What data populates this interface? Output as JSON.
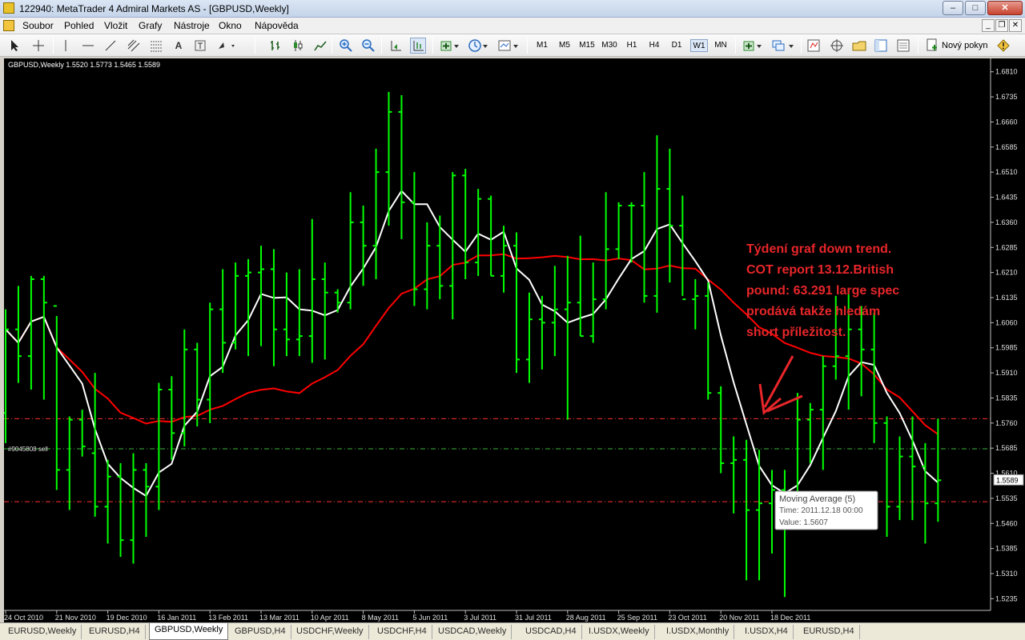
{
  "window": {
    "title": "122940: MetaTrader 4 Admiral Markets AS - [GBPUSD,Weekly]",
    "minimize": "–",
    "maximize": "□",
    "close": "✕",
    "mdi_minimize": "_",
    "mdi_restore": "❐",
    "mdi_close": "✕"
  },
  "menu": [
    "Soubor",
    "Pohled",
    "Vložit",
    "Grafy",
    "Nástroje",
    "Okno",
    "Nápověda"
  ],
  "toolbar": {
    "timeframes": [
      "M1",
      "M5",
      "M15",
      "M30",
      "H1",
      "H4",
      "D1",
      "W1",
      "MN"
    ],
    "active_timeframe": "W1",
    "new_order_label": "Nový pokyn",
    "tools": [
      "cursor-icon",
      "crosshair-icon",
      "vertical-line-icon",
      "horizontal-line-icon",
      "trendline-icon",
      "equidistant-channel-icon",
      "fibonacci-icon",
      "text-icon",
      "text-label-icon",
      "arrows-icon",
      "bar-chart-icon",
      "candlestick-icon",
      "line-chart-icon",
      "zoom-in-icon",
      "zoom-out-icon",
      "chart-shift-icon",
      "autoscroll-icon",
      "indicators-icon",
      "periods-icon",
      "templates-icon",
      "new-chart-icon",
      "profiles-icon",
      "market-watch-icon",
      "navigator-icon",
      "expert-advisors-icon",
      "data-window-icon",
      "terminal-icon",
      "new-order-icon",
      "metaeditor-icon"
    ]
  },
  "chart": {
    "header": "GBPUSD,Weekly  1.5520 1.5773 1.5465 1.5589",
    "symbol": "GBPUSD",
    "current_price_label": "1.5589",
    "order_label": "#9045808 sell",
    "background": "#000000",
    "bar_color": "#00ff00",
    "ma_fast_color": "#ffffff",
    "ma_slow_color": "#ff0000",
    "annotation": [
      "Týdení graf down trend.",
      "COT report 13.12.British",
      "pound: 63.291 large spec",
      "prodává takže hledám",
      "short příležitost."
    ],
    "annotation_color": "#e8262a",
    "tooltip": {
      "title": "Moving Average (5)",
      "time": "Time: 2011.12.18 00:00",
      "value": "Value: 1.5607"
    }
  },
  "chart_data": {
    "type": "ohlc",
    "ylim": [
      1.52,
      1.685
    ],
    "y_ticks": [
      "1.6810",
      "1.6735",
      "1.6660",
      "1.6585",
      "1.6510",
      "1.6435",
      "1.6360",
      "1.6285",
      "1.6210",
      "1.6135",
      "1.6060",
      "1.5985",
      "1.5910",
      "1.5835",
      "1.5760",
      "1.5685",
      "1.5610",
      "1.5535",
      "1.5460",
      "1.5385",
      "1.5310",
      "1.5235"
    ],
    "x_labels": [
      "24 Oct 2010",
      "21 Nov 2010",
      "19 Dec 2010",
      "16 Jan 2011",
      "13 Feb 2011",
      "13 Mar 2011",
      "10 Apr 2011",
      "8 May 2011",
      "5 Jun 2011",
      "3 Jul 2011",
      "31 Jul 2011",
      "28 Aug 2011",
      "25 Sep 2011",
      "23 Oct 2011",
      "20 Nov 2011",
      "18 Dec 2011"
    ],
    "horizontal_lines": [
      {
        "value": 1.5773,
        "color": "#ff3030",
        "style": "dash-dot"
      },
      {
        "value": 1.5683,
        "color": "#3cb43c",
        "style": "dash-dot"
      },
      {
        "value": 1.5525,
        "color": "#ff3030",
        "style": "dash-dot"
      }
    ],
    "bars": [
      {
        "o": 1.579,
        "h": 1.61,
        "l": 1.57,
        "c": 1.604
      },
      {
        "o": 1.604,
        "h": 1.617,
        "l": 1.588,
        "c": 1.596
      },
      {
        "o": 1.596,
        "h": 1.62,
        "l": 1.586,
        "c": 1.619
      },
      {
        "o": 1.619,
        "h": 1.62,
        "l": 1.583,
        "c": 1.612
      },
      {
        "o": 1.611,
        "h": 1.608,
        "l": 1.556,
        "c": 1.562
      },
      {
        "o": 1.562,
        "h": 1.578,
        "l": 1.55,
        "c": 1.577
      },
      {
        "o": 1.577,
        "h": 1.58,
        "l": 1.566,
        "c": 1.569
      },
      {
        "o": 1.567,
        "h": 1.591,
        "l": 1.548,
        "c": 1.551
      },
      {
        "o": 1.551,
        "h": 1.565,
        "l": 1.54,
        "c": 1.56
      },
      {
        "o": 1.56,
        "h": 1.564,
        "l": 1.536,
        "c": 1.541
      },
      {
        "o": 1.541,
        "h": 1.567,
        "l": 1.534,
        "c": 1.562
      },
      {
        "o": 1.562,
        "h": 1.564,
        "l": 1.542,
        "c": 1.557
      },
      {
        "o": 1.557,
        "h": 1.588,
        "l": 1.55,
        "c": 1.586
      },
      {
        "o": 1.586,
        "h": 1.59,
        "l": 1.565,
        "c": 1.573
      },
      {
        "o": 1.573,
        "h": 1.604,
        "l": 1.569,
        "c": 1.598
      },
      {
        "o": 1.598,
        "h": 1.6,
        "l": 1.575,
        "c": 1.583
      },
      {
        "o": 1.583,
        "h": 1.612,
        "l": 1.576,
        "c": 1.61
      },
      {
        "o": 1.61,
        "h": 1.622,
        "l": 1.591,
        "c": 1.6
      },
      {
        "o": 1.6,
        "h": 1.624,
        "l": 1.598,
        "c": 1.62
      },
      {
        "o": 1.62,
        "h": 1.625,
        "l": 1.596,
        "c": 1.621
      },
      {
        "o": 1.621,
        "h": 1.629,
        "l": 1.599,
        "c": 1.622
      },
      {
        "o": 1.622,
        "h": 1.628,
        "l": 1.593,
        "c": 1.604
      },
      {
        "o": 1.604,
        "h": 1.621,
        "l": 1.596,
        "c": 1.601
      },
      {
        "o": 1.601,
        "h": 1.622,
        "l": 1.596,
        "c": 1.602
      },
      {
        "o": 1.602,
        "h": 1.637,
        "l": 1.594,
        "c": 1.619
      },
      {
        "o": 1.619,
        "h": 1.624,
        "l": 1.595,
        "c": 1.615
      },
      {
        "o": 1.615,
        "h": 1.616,
        "l": 1.609,
        "c": 1.612
      },
      {
        "o": 1.612,
        "h": 1.645,
        "l": 1.61,
        "c": 1.636
      },
      {
        "o": 1.636,
        "h": 1.641,
        "l": 1.617,
        "c": 1.629
      },
      {
        "o": 1.629,
        "h": 1.658,
        "l": 1.619,
        "c": 1.651
      },
      {
        "o": 1.651,
        "h": 1.675,
        "l": 1.635,
        "c": 1.669
      },
      {
        "o": 1.669,
        "h": 1.674,
        "l": 1.631,
        "c": 1.642
      },
      {
        "o": 1.642,
        "h": 1.651,
        "l": 1.611,
        "c": 1.616
      },
      {
        "o": 1.616,
        "h": 1.636,
        "l": 1.61,
        "c": 1.629
      },
      {
        "o": 1.629,
        "h": 1.638,
        "l": 1.613,
        "c": 1.617
      },
      {
        "o": 1.617,
        "h": 1.651,
        "l": 1.607,
        "c": 1.65
      },
      {
        "o": 1.65,
        "h": 1.652,
        "l": 1.619,
        "c": 1.624
      },
      {
        "o": 1.624,
        "h": 1.646,
        "l": 1.62,
        "c": 1.643
      },
      {
        "o": 1.643,
        "h": 1.644,
        "l": 1.62,
        "c": 1.62
      },
      {
        "o": 1.62,
        "h": 1.635,
        "l": 1.615,
        "c": 1.629
      },
      {
        "o": 1.629,
        "h": 1.633,
        "l": 1.591,
        "c": 1.595
      },
      {
        "o": 1.595,
        "h": 1.615,
        "l": 1.588,
        "c": 1.607
      },
      {
        "o": 1.607,
        "h": 1.614,
        "l": 1.592,
        "c": 1.606
      },
      {
        "o": 1.606,
        "h": 1.623,
        "l": 1.596,
        "c": 1.61
      },
      {
        "o": 1.61,
        "h": 1.626,
        "l": 1.577,
        "c": 1.612
      },
      {
        "o": 1.612,
        "h": 1.632,
        "l": 1.602,
        "c": 1.602
      },
      {
        "o": 1.602,
        "h": 1.624,
        "l": 1.6,
        "c": 1.613
      },
      {
        "o": 1.613,
        "h": 1.645,
        "l": 1.61,
        "c": 1.628
      },
      {
        "o": 1.628,
        "h": 1.642,
        "l": 1.625,
        "c": 1.641
      },
      {
        "o": 1.641,
        "h": 1.642,
        "l": 1.624,
        "c": 1.641
      },
      {
        "o": 1.641,
        "h": 1.651,
        "l": 1.612,
        "c": 1.614
      },
      {
        "o": 1.614,
        "h": 1.662,
        "l": 1.609,
        "c": 1.646
      },
      {
        "o": 1.646,
        "h": 1.658,
        "l": 1.618,
        "c": 1.635
      },
      {
        "o": 1.635,
        "h": 1.644,
        "l": 1.614,
        "c": 1.613
      },
      {
        "o": 1.613,
        "h": 1.619,
        "l": 1.604,
        "c": 1.614
      },
      {
        "o": 1.614,
        "h": 1.618,
        "l": 1.583,
        "c": 1.585
      },
      {
        "o": 1.585,
        "h": 1.587,
        "l": 1.561,
        "c": 1.564
      },
      {
        "o": 1.564,
        "h": 1.572,
        "l": 1.549,
        "c": 1.565
      },
      {
        "o": 1.565,
        "h": 1.571,
        "l": 1.529,
        "c": 1.55
      },
      {
        "o": 1.55,
        "h": 1.568,
        "l": 1.529,
        "c": 1.552
      },
      {
        "o": 1.552,
        "h": 1.562,
        "l": 1.537,
        "c": 1.556
      },
      {
        "o": 1.556,
        "h": 1.562,
        "l": 1.524,
        "c": 1.552
      },
      {
        "o": 1.552,
        "h": 1.585,
        "l": 1.551,
        "c": 1.577
      },
      {
        "o": 1.577,
        "h": 1.582,
        "l": 1.564,
        "c": 1.58
      },
      {
        "o": 1.58,
        "h": 1.596,
        "l": 1.562,
        "c": 1.593
      },
      {
        "o": 1.593,
        "h": 1.614,
        "l": 1.589,
        "c": 1.596
      },
      {
        "o": 1.596,
        "h": 1.616,
        "l": 1.58,
        "c": 1.604
      },
      {
        "o": 1.604,
        "h": 1.611,
        "l": 1.584,
        "c": 1.598
      },
      {
        "o": 1.598,
        "h": 1.609,
        "l": 1.57,
        "c": 1.576
      },
      {
        "o": 1.576,
        "h": 1.578,
        "l": 1.542,
        "c": 1.551
      },
      {
        "o": 1.551,
        "h": 1.572,
        "l": 1.547,
        "c": 1.566
      },
      {
        "o": 1.566,
        "h": 1.578,
        "l": 1.547,
        "c": 1.563
      },
      {
        "o": 1.563,
        "h": 1.57,
        "l": 1.54,
        "c": 1.552
      },
      {
        "o": 1.552,
        "h": 1.5773,
        "l": 1.5465,
        "c": 1.5589
      }
    ],
    "ma_fast": {
      "name": "Moving Average (5)",
      "period": 5,
      "color": "#ffffff"
    },
    "ma_slow": {
      "period": 20,
      "color": "#ff0000"
    }
  },
  "tabs": [
    {
      "label": "EURUSD,Weekly",
      "active": false
    },
    {
      "label": "EURUSD,H4",
      "active": false
    },
    {
      "label": "GBPUSD,Weekly",
      "active": true
    },
    {
      "label": "GBPUSD,H4",
      "active": false
    },
    {
      "label": "USDCHF,Weekly",
      "active": false
    },
    {
      "label": "USDCHF,H4",
      "active": false
    },
    {
      "label": "USDCAD,Weekly",
      "active": false
    },
    {
      "label": "USDCAD,H4",
      "active": false
    },
    {
      "label": "I.USDX,Weekly",
      "active": false
    },
    {
      "label": "I.USDX,Monthly",
      "active": false
    },
    {
      "label": "I.USDX,H4",
      "active": false
    },
    {
      "label": "EURUSD,H4",
      "active": false
    }
  ]
}
